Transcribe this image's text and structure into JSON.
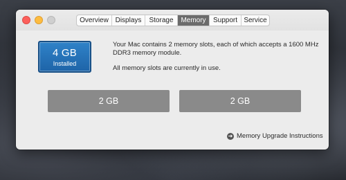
{
  "tabs": [
    {
      "label": "Overview"
    },
    {
      "label": "Displays"
    },
    {
      "label": "Storage"
    },
    {
      "label": "Memory"
    },
    {
      "label": "Support"
    },
    {
      "label": "Service"
    }
  ],
  "active_tab": "Memory",
  "memory_summary": {
    "size": "4 GB",
    "status": "Installed",
    "icon_color": "#1e64a8"
  },
  "description": {
    "line1": "Your Mac contains 2 memory slots, each of which accepts a 1600 MHz DDR3 memory module.",
    "line2": "All memory slots are currently in use."
  },
  "slots": [
    {
      "size": "2 GB"
    },
    {
      "size": "2 GB"
    }
  ],
  "upgrade_link": {
    "label": "Memory Upgrade Instructions",
    "icon": "arrow-circle-right-icon"
  }
}
